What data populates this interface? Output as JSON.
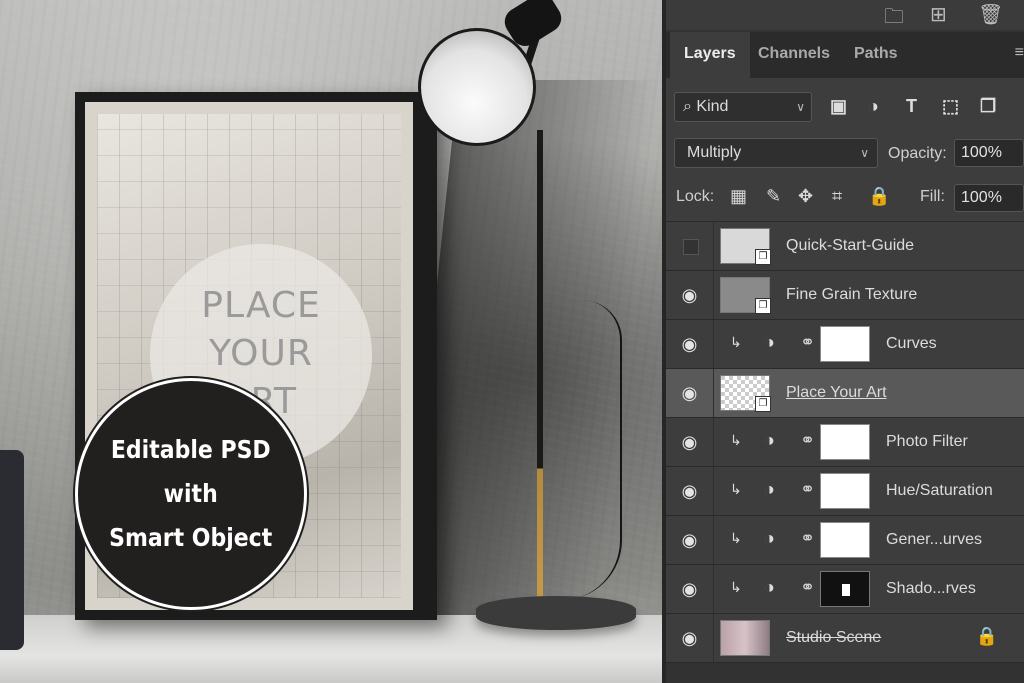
{
  "poster": {
    "place_lines": [
      "PLACE",
      "YOUR",
      "ART"
    ]
  },
  "badge": {
    "lines": [
      "Editable PSD",
      "with",
      "Smart Object"
    ]
  },
  "panel": {
    "tabs": [
      {
        "label": "Layers",
        "active": true
      },
      {
        "label": "Channels",
        "active": false
      },
      {
        "label": "Paths",
        "active": false
      }
    ],
    "filter": {
      "kind_label": "Kind"
    },
    "blend_mode": "Multiply",
    "opacity_label": "Opacity:",
    "opacity_value": "100%",
    "lock_label": "Lock:",
    "fill_label": "Fill:",
    "fill_value": "100%",
    "layers": [
      {
        "name": "Quick-Start-Guide",
        "visible": false,
        "type": "smart-object",
        "selected": false
      },
      {
        "name": "Fine Grain Texture",
        "visible": true,
        "type": "smart-object",
        "selected": false
      },
      {
        "name": "Curves",
        "visible": true,
        "type": "adjustment",
        "selected": false
      },
      {
        "name": "Place Your Art",
        "visible": true,
        "type": "smart-object",
        "selected": true
      },
      {
        "name": "Photo Filter",
        "visible": true,
        "type": "adjustment",
        "selected": false
      },
      {
        "name": "Hue/Saturation",
        "visible": true,
        "type": "adjustment",
        "selected": false
      },
      {
        "name": "Gener...urves",
        "visible": true,
        "type": "adjustment",
        "selected": false
      },
      {
        "name": "Shado...rves",
        "visible": true,
        "type": "adjustment",
        "selected": false
      },
      {
        "name": "Studio Scene",
        "visible": true,
        "type": "image",
        "selected": false,
        "locked": true
      }
    ]
  }
}
